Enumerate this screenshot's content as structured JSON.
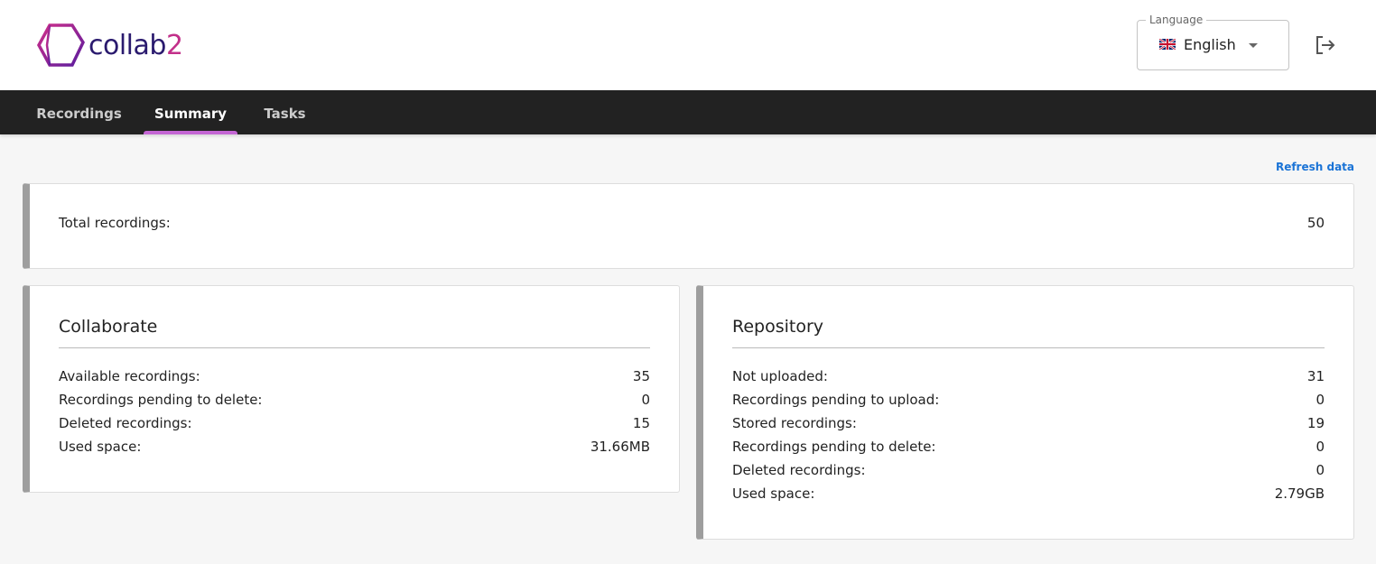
{
  "header": {
    "logo_text": "collab",
    "logo_text_suffix": "2",
    "language": {
      "label": "Language",
      "value": "English",
      "flag": "uk-flag-icon"
    },
    "logout_icon": "logout-icon"
  },
  "nav": {
    "tabs": [
      {
        "label": "Recordings",
        "active": false
      },
      {
        "label": "Summary",
        "active": true
      },
      {
        "label": "Tasks",
        "active": false
      }
    ],
    "accent": "#c466d4"
  },
  "main": {
    "refresh_label": "Refresh data",
    "total": {
      "label": "Total recordings:",
      "value": "50"
    },
    "collaborate": {
      "title": "Collaborate",
      "rows": [
        {
          "label": "Available recordings:",
          "value": "35"
        },
        {
          "label": "Recordings pending to delete:",
          "value": "0"
        },
        {
          "label": "Deleted recordings:",
          "value": "15"
        },
        {
          "label": "Used space:",
          "value": "31.66MB"
        }
      ]
    },
    "repository": {
      "title": "Repository",
      "rows": [
        {
          "label": "Not uploaded:",
          "value": "31"
        },
        {
          "label": "Recordings pending to upload:",
          "value": "0"
        },
        {
          "label": "Stored recordings:",
          "value": "19"
        },
        {
          "label": "Recordings pending to delete:",
          "value": "0"
        },
        {
          "label": "Deleted recordings:",
          "value": "0"
        },
        {
          "label": "Used space:",
          "value": "2.79GB"
        }
      ]
    }
  }
}
